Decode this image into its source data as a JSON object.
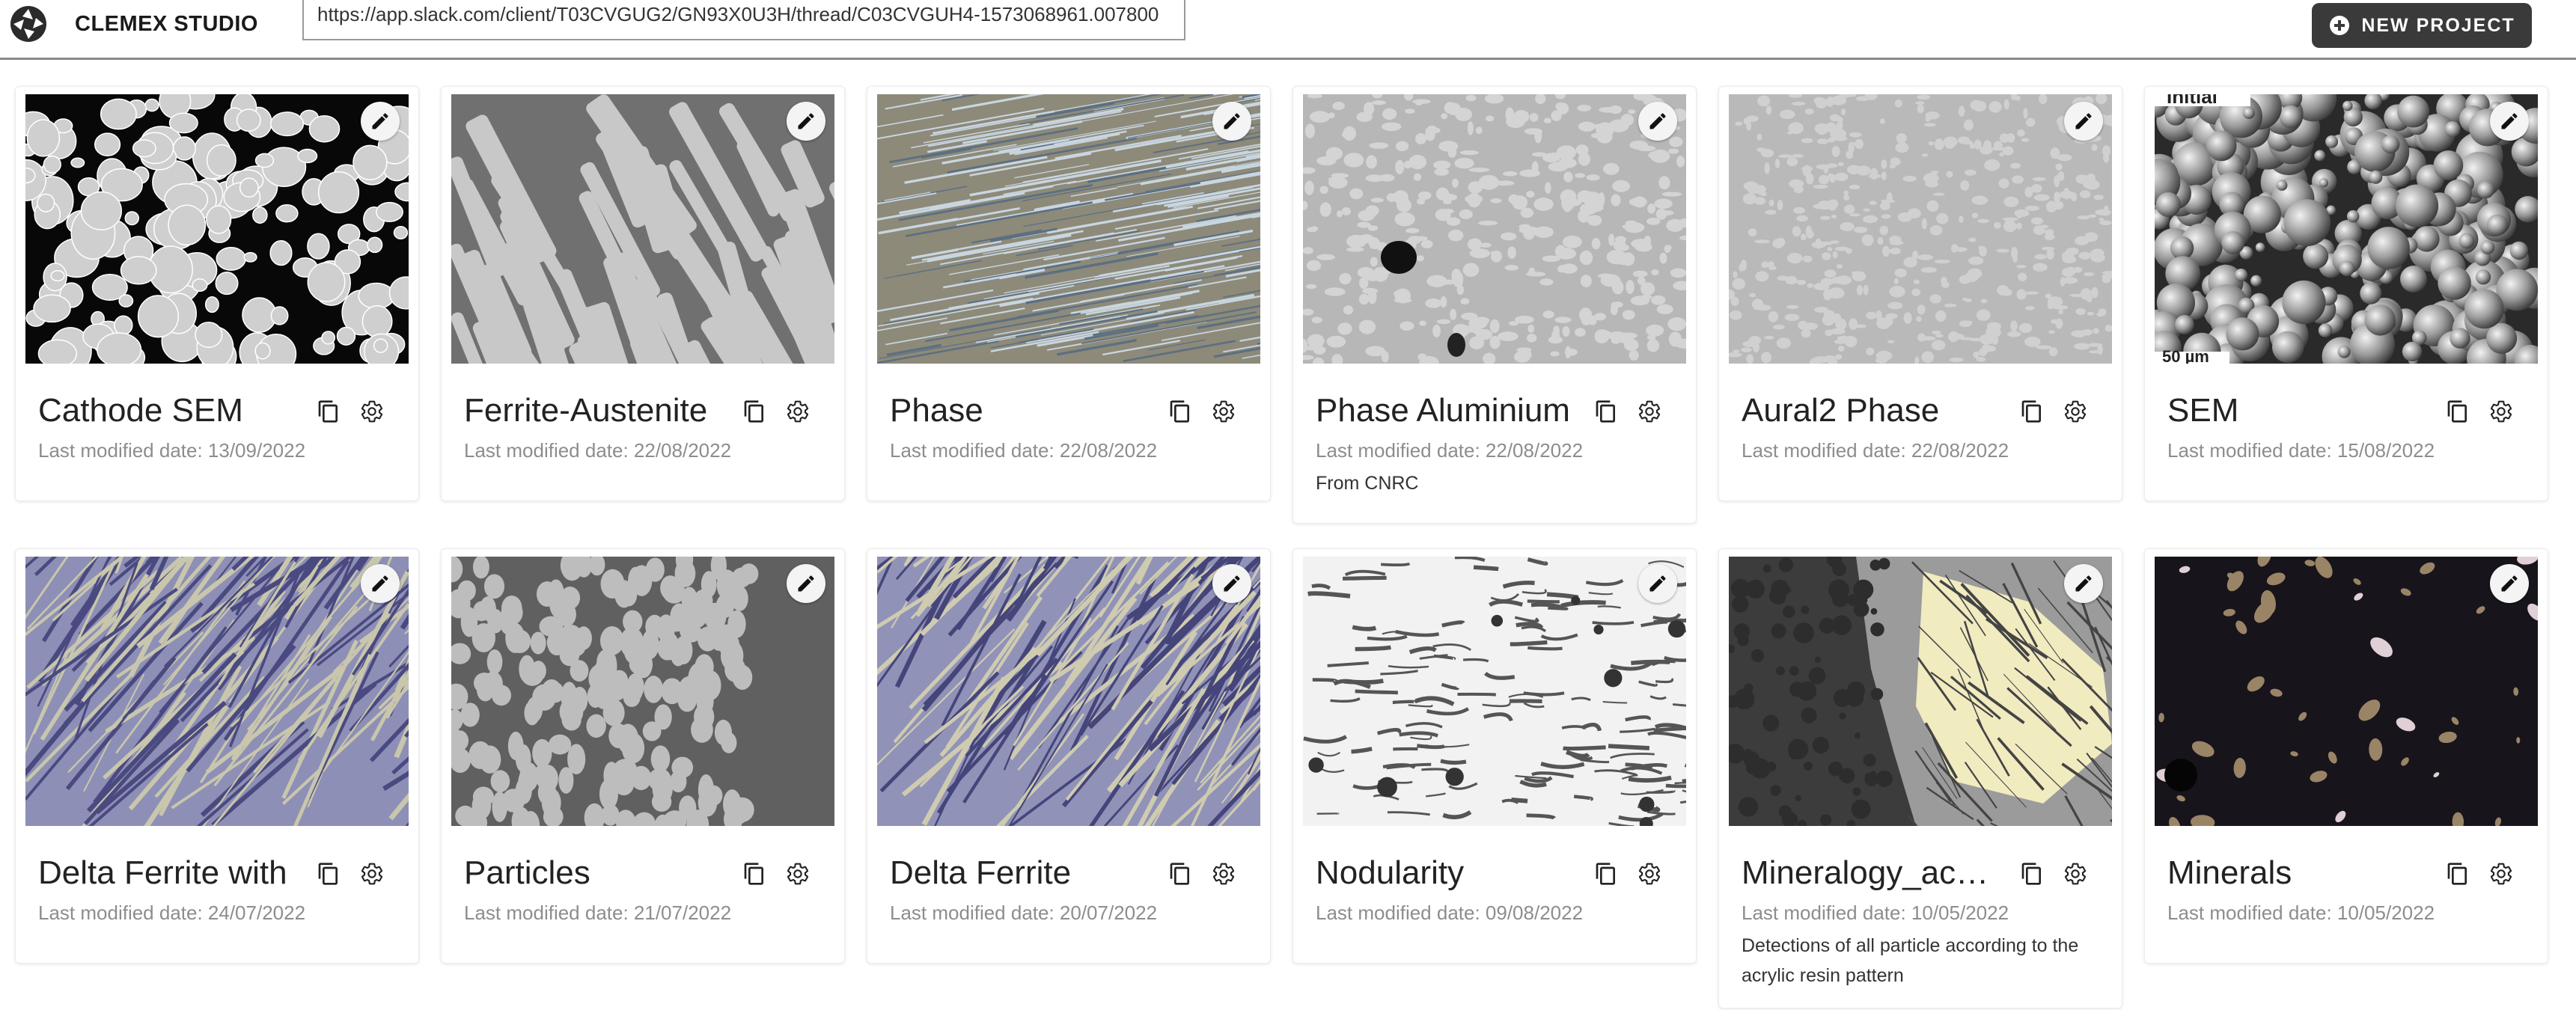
{
  "app": {
    "brand": "CLEMEX STUDIO",
    "url": "https://app.slack.com/client/T03CVGUG2/GN93X0U3H/thread/C03CVGUH4-1573068961.007800"
  },
  "toolbar": {
    "new_project_label": "NEW PROJECT"
  },
  "projects": [
    {
      "title": "Cathode SEM",
      "date": "Last modified date: 13/09/2022",
      "description": ""
    },
    {
      "title": "Ferrite-Austenite",
      "date": "Last modified date: 22/08/2022",
      "description": ""
    },
    {
      "title": "Phase",
      "date": "Last modified date: 22/08/2022",
      "description": ""
    },
    {
      "title": "Phase Aluminium",
      "date": "Last modified date: 22/08/2022",
      "description": "From CNRC"
    },
    {
      "title": "Aural2 Phase",
      "date": "Last modified date: 22/08/2022",
      "description": ""
    },
    {
      "title": "SEM",
      "date": "Last modified date: 15/08/2022",
      "description": "",
      "overlay_top": "Initial",
      "overlay_bottom": "50 µm"
    },
    {
      "title": "Delta Ferrite with",
      "date": "Last modified date: 24/07/2022",
      "description": ""
    },
    {
      "title": "Particles",
      "date": "Last modified date: 21/07/2022",
      "description": ""
    },
    {
      "title": "Delta Ferrite",
      "date": "Last modified date: 20/07/2022",
      "description": ""
    },
    {
      "title": "Nodularity",
      "date": "Last modified date: 09/08/2022",
      "description": ""
    },
    {
      "title": "Mineralogy_acrylic",
      "date": "Last modified date: 10/05/2022",
      "description": "Detections of all particle according to the acrylic resin pattern"
    },
    {
      "title": "Minerals",
      "date": "Last modified date: 10/05/2022",
      "description": ""
    }
  ],
  "colors": {
    "button_bg": "#3a3a3a",
    "date_text": "#8d8d8d"
  }
}
